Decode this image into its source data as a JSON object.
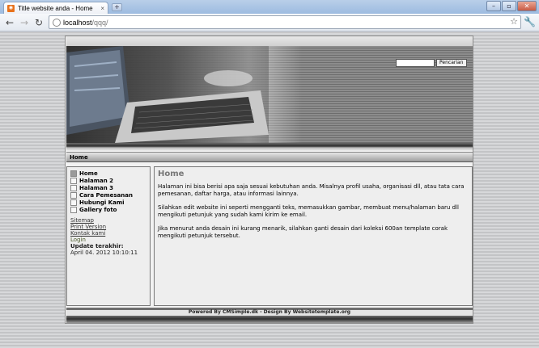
{
  "browser": {
    "tab_title": "Title website anda - Home",
    "tab_close": "×",
    "new_tab": "+",
    "favicon": "rss-favicon",
    "url_host": "localhost",
    "url_path": "/qqq/",
    "window_buttons": {
      "minimize": "–",
      "maximize": "▫",
      "close": "✕"
    },
    "nav": {
      "back": "←",
      "forward": "→",
      "reload": "↻"
    }
  },
  "site": {
    "search": {
      "button": "Pencarian",
      "placeholder": ""
    },
    "breadcrumb": "Home",
    "menu": [
      {
        "label": "Home",
        "active": true
      },
      {
        "label": "Halaman 2",
        "active": false
      },
      {
        "label": "Halaman 3",
        "active": false
      },
      {
        "label": "Cara Pemesanan",
        "active": false
      },
      {
        "label": "Hubungi Kami",
        "active": false
      },
      {
        "label": "Gallery foto",
        "active": false
      }
    ],
    "links": {
      "sitemap": "Sitemap",
      "print": "Print Version",
      "contact": "Kontak kami",
      "login": "Login"
    },
    "updated_label": "Update terakhir:",
    "updated_date": "April 04. 2012 10:10:11",
    "content": {
      "title": "Home",
      "p1": "Halaman ini bisa berisi apa saja sesuai kebutuhan anda. Misalnya profil usaha, organisasi dll, atau tata cara pemesanan, daftar harga, atau informasi lainnya.",
      "p2": "Silahkan edit website ini seperti mengganti teks, memasukkan gambar, membuat menu/halaman baru dll mengikuti petunjuk yang sudah kami kirim ke email.",
      "p3": "Jika menurut anda desain ini kurang menarik, silahkan ganti desain dari koleksi 600an template corak mengikuti petunjuk tersebut."
    },
    "footer": "Powered By CMSimple.dk - Design By Websitetemplate.org"
  }
}
